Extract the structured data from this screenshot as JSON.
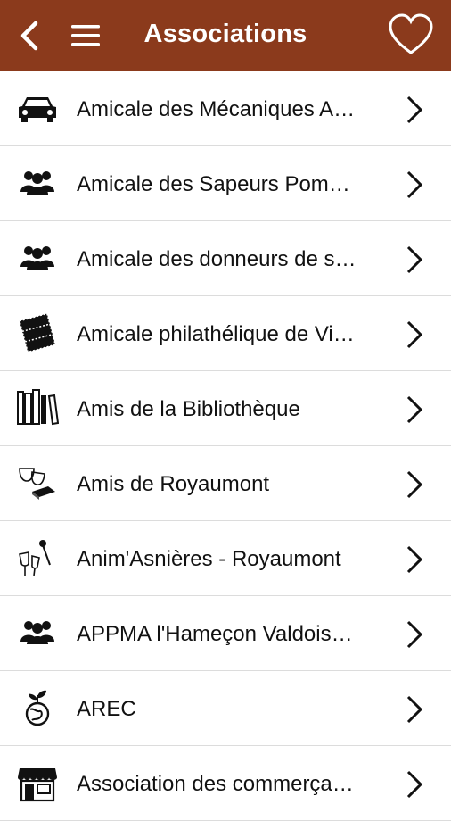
{
  "header": {
    "title": "Associations",
    "back_icon": "chevron-left-icon",
    "menu_icon": "hamburger-menu-icon",
    "favorite_icon": "heart-outline-icon",
    "color": "#8b3a1c"
  },
  "items": [
    {
      "label": "Amicale des Mécaniques A…",
      "icon": "car-icon"
    },
    {
      "label": "Amicale des Sapeurs Pom…",
      "icon": "group-icon"
    },
    {
      "label": "Amicale des donneurs de s…",
      "icon": "group-icon"
    },
    {
      "label": "Amicale philathélique de Vi…",
      "icon": "stamps-icon"
    },
    {
      "label": "Amis de la Bibliothèque",
      "icon": "books-icon"
    },
    {
      "label": "Amis de Royaumont",
      "icon": "theater-masks-icon"
    },
    {
      "label": "Anim'Asnières - Royaumont",
      "icon": "microphone-icon"
    },
    {
      "label": "APPMA l'Hameçon Valdois…",
      "icon": "group-icon"
    },
    {
      "label": "AREC",
      "icon": "earth-plant-icon"
    },
    {
      "label": "Association des commerça…",
      "icon": "shop-icon"
    }
  ]
}
